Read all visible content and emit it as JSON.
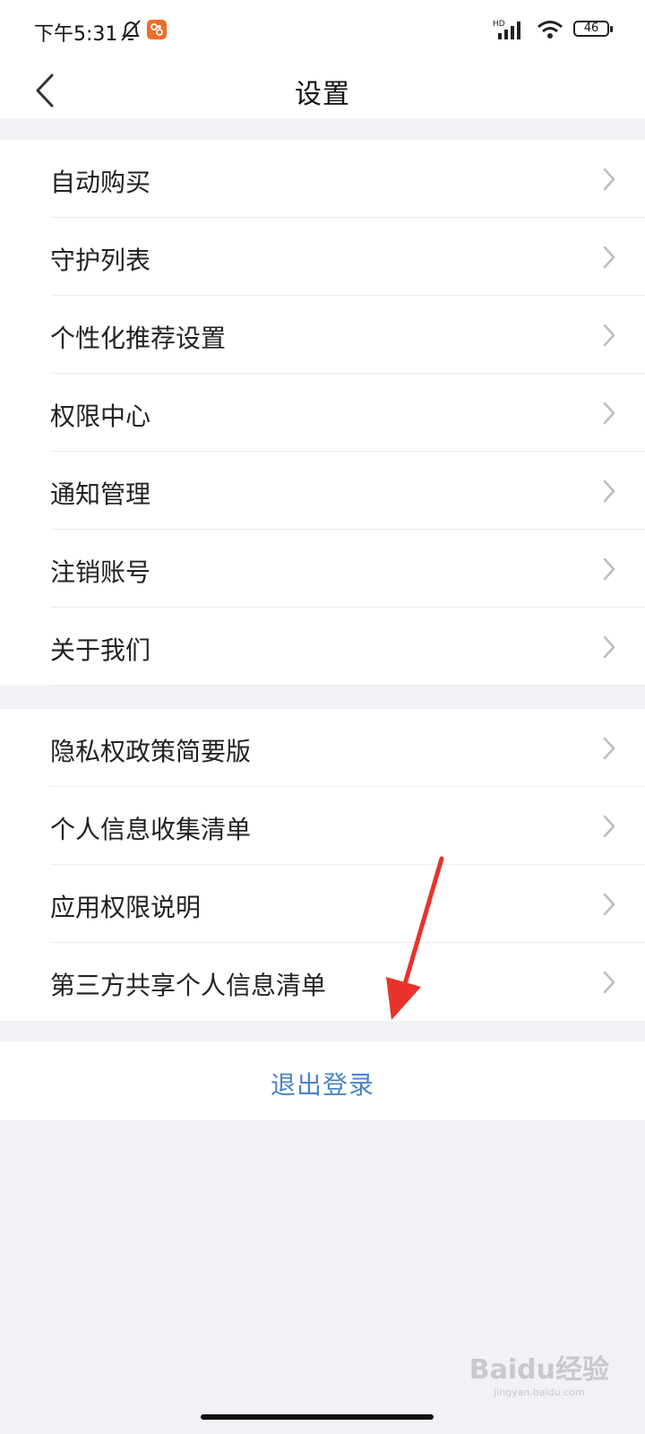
{
  "status_bar": {
    "time": "下午5:31",
    "network": "HD",
    "battery": "46"
  },
  "header": {
    "title": "设置",
    "back_icon": "chevron-left-icon"
  },
  "groups": [
    {
      "items": [
        {
          "label": "自动购买"
        },
        {
          "label": "守护列表"
        },
        {
          "label": "个性化推荐设置"
        },
        {
          "label": "权限中心"
        },
        {
          "label": "通知管理"
        },
        {
          "label": "注销账号"
        },
        {
          "label": "关于我们"
        }
      ]
    },
    {
      "items": [
        {
          "label": "隐私权政策简要版"
        },
        {
          "label": "个人信息收集清单"
        },
        {
          "label": "应用权限说明"
        },
        {
          "label": "第三方共享个人信息清单"
        }
      ]
    }
  ],
  "logout": {
    "label": "退出登录"
  },
  "watermark": {
    "logo": "Baidu经验",
    "url": "jingyan.baidu.com"
  },
  "colors": {
    "background": "#f2f2f6",
    "link": "#4a84c7",
    "annotation_arrow": "#e8332a",
    "app_badge": "#f26b2b"
  }
}
